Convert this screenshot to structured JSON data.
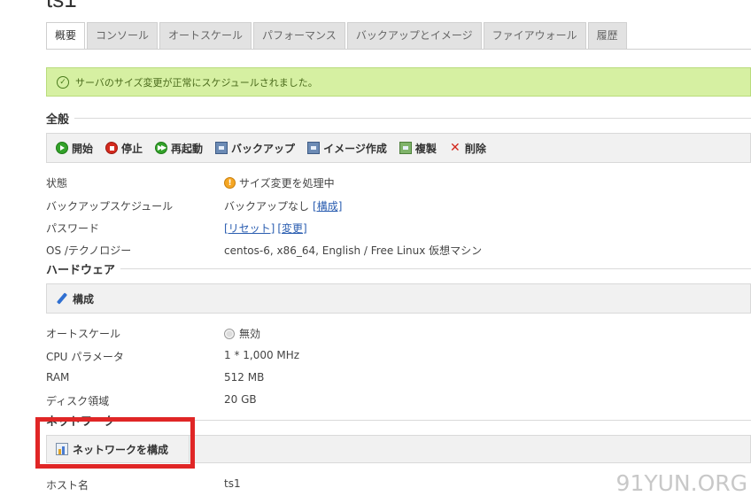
{
  "page": {
    "title": "ts1"
  },
  "tabs": [
    {
      "label": "概要",
      "active": true
    },
    {
      "label": "コンソール",
      "active": false
    },
    {
      "label": "オートスケール",
      "active": false
    },
    {
      "label": "パフォーマンス",
      "active": false
    },
    {
      "label": "バックアップとイメージ",
      "active": false
    },
    {
      "label": "ファイアウォール",
      "active": false
    },
    {
      "label": "履歴",
      "active": false
    }
  ],
  "alert": {
    "message": "サーバのサイズ変更が正常にスケジュールされました。",
    "icon": "check-circle-icon",
    "color": "#d6f0a2"
  },
  "general": {
    "heading": "全般",
    "toolbar": {
      "start": "開始",
      "stop": "停止",
      "restart": "再起動",
      "backup": "バックアップ",
      "create_image": "イメージ作成",
      "clone": "複製",
      "delete": "削除"
    },
    "rows": {
      "status_label": "状態",
      "status_value": "サイズ変更を処理中",
      "backup_schedule_label": "バックアップスケジュール",
      "backup_schedule_value": "バックアップなし",
      "backup_schedule_link": "[構成]",
      "password_label": "パスワード",
      "password_reset_link": "[リセット]",
      "password_change_link": "[変更]",
      "os_label": "OS /テクノロジー",
      "os_value": "centos-6, x86_64, English / Free Linux 仮想マシン"
    }
  },
  "hardware": {
    "heading": "ハードウェア",
    "configure": "構成",
    "rows": {
      "autoscale_label": "オートスケール",
      "autoscale_value": "無効",
      "cpu_label": "CPU パラメータ",
      "cpu_value": "1 * 1,000 MHz",
      "ram_label": "RAM",
      "ram_value": "512 MB",
      "disk_label": "ディスク領域",
      "disk_value": "20 GB"
    }
  },
  "network": {
    "heading": "ネットワーク",
    "configure": "ネットワークを構成",
    "hostname_label": "ホスト名",
    "hostname_value": "ts1"
  },
  "watermark": "91YUN.ORG",
  "colors": {
    "highlight": "#e02626",
    "link": "#2a5db0",
    "ok": "#33a22a",
    "stop": "#d42a1e"
  }
}
